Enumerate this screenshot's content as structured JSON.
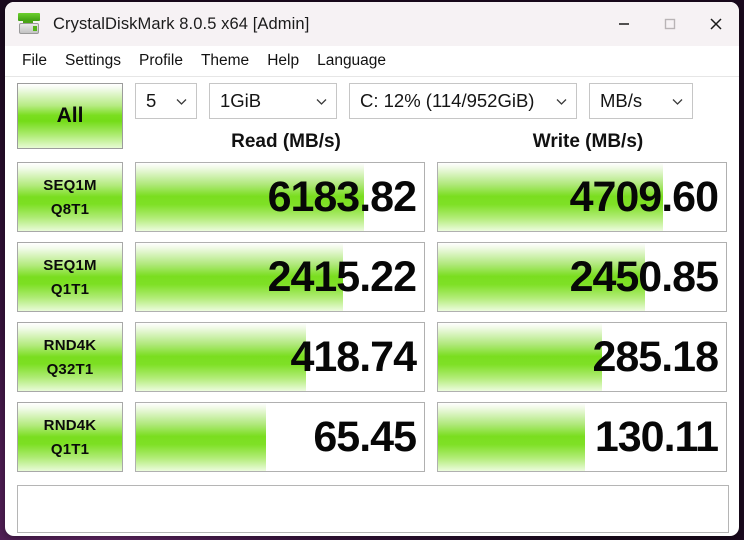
{
  "window": {
    "title": "CrystalDiskMark 8.0.5 x64 [Admin]",
    "icon": "disk-drive-icon",
    "controls": {
      "minimize": "minimize-icon",
      "maximize": "maximize-icon",
      "close": "close-icon"
    }
  },
  "menu": {
    "items": [
      {
        "label": "File"
      },
      {
        "label": "Settings"
      },
      {
        "label": "Profile"
      },
      {
        "label": "Theme"
      },
      {
        "label": "Help"
      },
      {
        "label": "Language"
      }
    ]
  },
  "toolbar": {
    "all_button": "All",
    "count": "5",
    "size": "1GiB",
    "drive": "C: 12% (114/952GiB)",
    "unit": "MB/s",
    "chevron": "chevron-down-icon"
  },
  "headers": {
    "read": "Read (MB/s)",
    "write": "Write (MB/s)"
  },
  "comment": "",
  "colors": {
    "accent_green": "#7ade1f",
    "titlebar": "#f6f2f4",
    "text": "#111111"
  },
  "chart_data": {
    "type": "bar",
    "title": "CrystalDiskMark 8.0.5 x64 Benchmark Results",
    "unit": "MB/s",
    "test_size": "1GiB",
    "test_count": "5",
    "drive": "C: 12% (114/952GiB)",
    "categories": [
      "SEQ1M Q8T1",
      "SEQ1M Q1T1",
      "RND4K Q32T1",
      "RND4K Q1T1"
    ],
    "series": [
      {
        "name": "Read (MB/s)",
        "values": [
          6183.82,
          2415.22,
          418.74,
          65.45
        ]
      },
      {
        "name": "Write (MB/s)",
        "values": [
          4709.6,
          2450.85,
          285.18,
          130.11
        ]
      }
    ],
    "xlabel": "",
    "ylabel": "MB/s",
    "legend": [
      "Read (MB/s)",
      "Write (MB/s)"
    ]
  },
  "rows": [
    {
      "label_line1": "SEQ1M",
      "label_line2": "Q8T1",
      "read": {
        "value": "6183.82",
        "fill_pct": 79
      },
      "write": {
        "value": "4709.60",
        "fill_pct": 78
      }
    },
    {
      "label_line1": "SEQ1M",
      "label_line2": "Q1T1",
      "read": {
        "value": "2415.22",
        "fill_pct": 72
      },
      "write": {
        "value": "2450.85",
        "fill_pct": 72
      }
    },
    {
      "label_line1": "RND4K",
      "label_line2": "Q32T1",
      "read": {
        "value": "418.74",
        "fill_pct": 59
      },
      "write": {
        "value": "285.18",
        "fill_pct": 57
      }
    },
    {
      "label_line1": "RND4K",
      "label_line2": "Q1T1",
      "read": {
        "value": "65.45",
        "fill_pct": 45
      },
      "write": {
        "value": "130.11",
        "fill_pct": 51
      }
    }
  ]
}
